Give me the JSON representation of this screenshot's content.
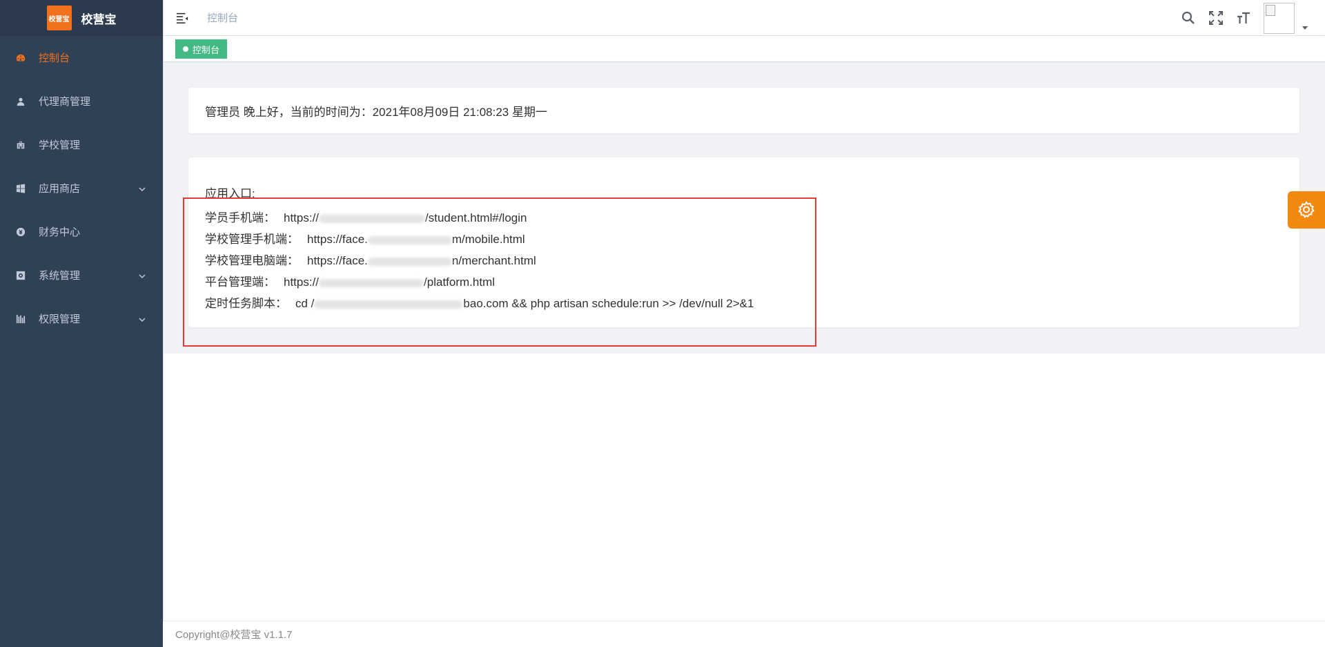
{
  "brand": {
    "logo_text": "校营宝",
    "title": "校营宝"
  },
  "sidebar": {
    "items": [
      {
        "label": "控制台",
        "icon": "dashboard-icon",
        "active": true,
        "expandable": false
      },
      {
        "label": "代理商管理",
        "icon": "user-icon",
        "active": false,
        "expandable": false
      },
      {
        "label": "学校管理",
        "icon": "school-icon",
        "active": false,
        "expandable": false
      },
      {
        "label": "应用商店",
        "icon": "windows-icon",
        "active": false,
        "expandable": true
      },
      {
        "label": "财务中心",
        "icon": "money-icon",
        "active": false,
        "expandable": false
      },
      {
        "label": "系统管理",
        "icon": "system-icon",
        "active": false,
        "expandable": true
      },
      {
        "label": "权限管理",
        "icon": "chart-icon",
        "active": false,
        "expandable": true
      }
    ]
  },
  "header": {
    "breadcrumb": "控制台",
    "tools": [
      "search-icon",
      "fullscreen-icon",
      "font-size-icon"
    ]
  },
  "tags": {
    "active_tag": "控制台"
  },
  "greeting": {
    "text": "管理员 晚上好，当前的时间为：2021年08月09日 21:08:23 星期一"
  },
  "entry": {
    "title": "应用入口:",
    "lines": [
      {
        "label": "学员手机端：",
        "prefix": "https://",
        "suffix": "/student.html#/login"
      },
      {
        "label": "学校管理手机端：",
        "prefix": "https://face.",
        "suffix": "m/mobile.html"
      },
      {
        "label": "学校管理电脑端：",
        "prefix": "https://face.",
        "suffix": "n/merchant.html"
      },
      {
        "label": "平台管理端：",
        "prefix": "https://",
        "suffix": "/platform.html"
      },
      {
        "label": "定时任务脚本：",
        "prefix": "cd /",
        "suffix": "bao.com && php artisan schedule:run >> /dev/null 2>&1"
      }
    ]
  },
  "footer": {
    "text": "Copyright@校营宝 v1.1.7"
  },
  "colors": {
    "sidebar_bg": "#304156",
    "accent": "#f2711c",
    "tag_green": "#42b983",
    "highlight_red": "#e53935"
  }
}
